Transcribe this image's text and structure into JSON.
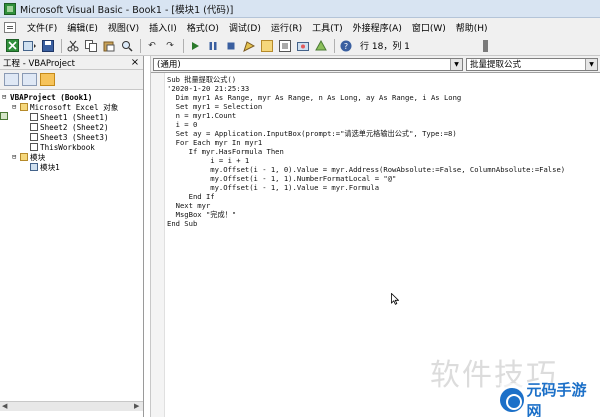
{
  "window": {
    "title": "Microsoft Visual Basic - Book1 - [模块1 (代码)]"
  },
  "menu": {
    "items": [
      "文件(F)",
      "编辑(E)",
      "视图(V)",
      "插入(I)",
      "格式(O)",
      "调试(D)",
      "运行(R)",
      "工具(T)",
      "外接程序(A)",
      "窗口(W)",
      "帮助(H)"
    ]
  },
  "toolbar": {
    "cursor_pos": "行 18，列 1",
    "icons": [
      "excel-icon",
      "insert-module-icon",
      "save-icon",
      "cut-icon",
      "copy-icon",
      "paste-icon",
      "find-icon",
      "undo-icon",
      "redo-icon",
      "run-icon",
      "break-icon",
      "reset-icon",
      "design-mode-icon",
      "project-explorer-icon",
      "properties-icon",
      "object-browser-icon",
      "toolbox-icon",
      "help-icon"
    ]
  },
  "project_panel": {
    "title": "工程 - VBAProject",
    "close": "×",
    "tree": [
      {
        "label": "VBAProject (Book1)",
        "level": 0,
        "toggle": "⊟",
        "icon": "project"
      },
      {
        "label": "Microsoft Excel 对象",
        "level": 1,
        "toggle": "⊟",
        "icon": "folder"
      },
      {
        "label": "Sheet1 (Sheet1)",
        "level": 2,
        "toggle": "",
        "icon": "sheet"
      },
      {
        "label": "Sheet2 (Sheet2)",
        "level": 2,
        "toggle": "",
        "icon": "sheet"
      },
      {
        "label": "Sheet3 (Sheet3)",
        "level": 2,
        "toggle": "",
        "icon": "sheet"
      },
      {
        "label": "ThisWorkbook",
        "level": 2,
        "toggle": "",
        "icon": "sheet"
      },
      {
        "label": "模块",
        "level": 1,
        "toggle": "⊟",
        "icon": "folder"
      },
      {
        "label": "模块1",
        "level": 2,
        "toggle": "",
        "icon": "module"
      }
    ]
  },
  "code_window": {
    "object_combo": "(通用)",
    "proc_combo": "批量提取公式",
    "lines": [
      "Sub 批量提取公式()",
      "'2020-1-20 21:25:33",
      "  Dim myr1 As Range, myr As Range, n As Long, ay As Range, i As Long",
      "  Set myr1 = Selection",
      "  n = myr1.Count",
      "  i = 0",
      "  Set ay = Application.InputBox(prompt:=\"请选单元格输出公式\", Type:=8)",
      "  For Each myr In myr1",
      "     If myr.HasFormula Then",
      "          i = i + 1",
      "          my.Offset(i - 1, 0).Value = myr.Address(RowAbsolute:=False, ColumnAbsolute:=False)",
      "          my.Offset(i - 1, 1).NumberFormatLocal = \"@\"",
      "          my.Offset(i - 1, 1).Value = myr.Formula",
      "     End If",
      "  Next myr",
      "  MsgBox \"完成！\"",
      "End Sub"
    ]
  },
  "watermark": {
    "text": "软件技巧",
    "logo_text": "元码手游网"
  }
}
